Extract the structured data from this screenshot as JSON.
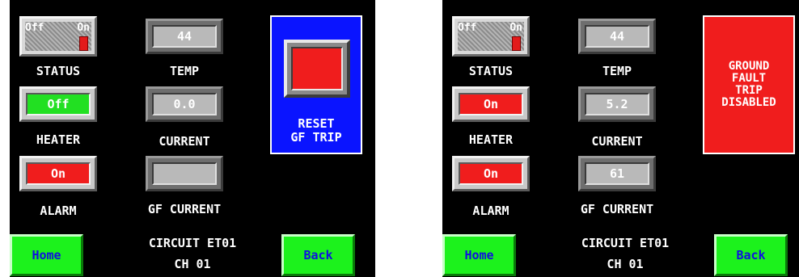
{
  "panels": [
    {
      "status": {
        "off_label": "Off",
        "on_label": "On",
        "label": "STATUS"
      },
      "temp": {
        "value": "44",
        "label": "TEMP"
      },
      "heater": {
        "value": "Off",
        "label": "HEATER",
        "color": "#22e022"
      },
      "current": {
        "value": "0.0",
        "label": "CURRENT"
      },
      "alarm": {
        "value": "On",
        "label": "ALARM",
        "color": "#f01d1d"
      },
      "gf_current": {
        "value": "",
        "label": "GF CURRENT"
      },
      "reset": {
        "line1": "RESET",
        "line2": "GF TRIP"
      },
      "home_label": "Home",
      "back_label": "Back",
      "circuit": "CIRCUIT ET01",
      "channel": "CH 01"
    },
    {
      "status": {
        "off_label": "Off",
        "on_label": "On",
        "label": "STATUS"
      },
      "temp": {
        "value": "44",
        "label": "TEMP"
      },
      "heater": {
        "value": "On",
        "label": "HEATER",
        "color": "#f01d1d"
      },
      "current": {
        "value": "5.2",
        "label": "CURRENT"
      },
      "alarm": {
        "value": "On",
        "label": "ALARM",
        "color": "#f01d1d"
      },
      "gf_current": {
        "value": "61",
        "label": "GF CURRENT"
      },
      "fault": {
        "line1": "GROUND",
        "line2": "FAULT",
        "line3": "TRIP",
        "line4": "DISABLED"
      },
      "home_label": "Home",
      "back_label": "Back",
      "circuit": "CIRCUIT ET01",
      "channel": "CH 01"
    }
  ],
  "colors": {
    "background": "#000000",
    "nav_green": "#1cf21c",
    "nav_text": "#1010e0",
    "panel_blue": "#0a14ff",
    "alert_red": "#f01d1d"
  }
}
